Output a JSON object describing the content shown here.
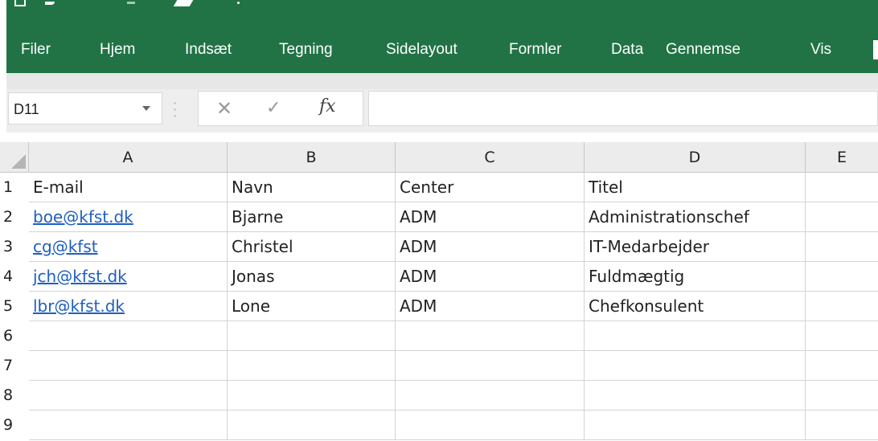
{
  "ribbon": {
    "tabs": [
      "Filer",
      "Hjem",
      "Indsæt",
      "Tegning",
      "Sidelayout",
      "Formler",
      "Data",
      "Gennemse",
      "Vis"
    ]
  },
  "formula_bar": {
    "name_box": "D11",
    "fx_label": "fx",
    "formula": ""
  },
  "sheet": {
    "columns": [
      "A",
      "B",
      "C",
      "D",
      "E"
    ],
    "row_numbers": [
      "1",
      "2",
      "3",
      "4",
      "5",
      "6",
      "7",
      "8",
      "9"
    ],
    "rows": [
      [
        "E-mail",
        "Navn",
        "Center",
        "Titel",
        ""
      ],
      [
        "boe@kfst.dk",
        "Bjarne",
        "ADM",
        "Administrationschef",
        ""
      ],
      [
        "cg@kfst",
        "Christel",
        "ADM",
        "IT-Medarbejder",
        ""
      ],
      [
        "jch@kfst.dk",
        "Jonas",
        "ADM",
        "Fuldmægtig",
        ""
      ],
      [
        "lbr@kfst.dk",
        "Lone",
        "ADM",
        "Chefkonsulent",
        ""
      ],
      [
        "",
        "",
        "",
        "",
        ""
      ],
      [
        "",
        "",
        "",
        "",
        ""
      ],
      [
        "",
        "",
        "",
        "",
        ""
      ],
      [
        "",
        "",
        "",
        "",
        ""
      ]
    ]
  },
  "colors": {
    "ribbon": "#217346",
    "link": "#1f5fbf",
    "header_bg": "#ececec"
  }
}
